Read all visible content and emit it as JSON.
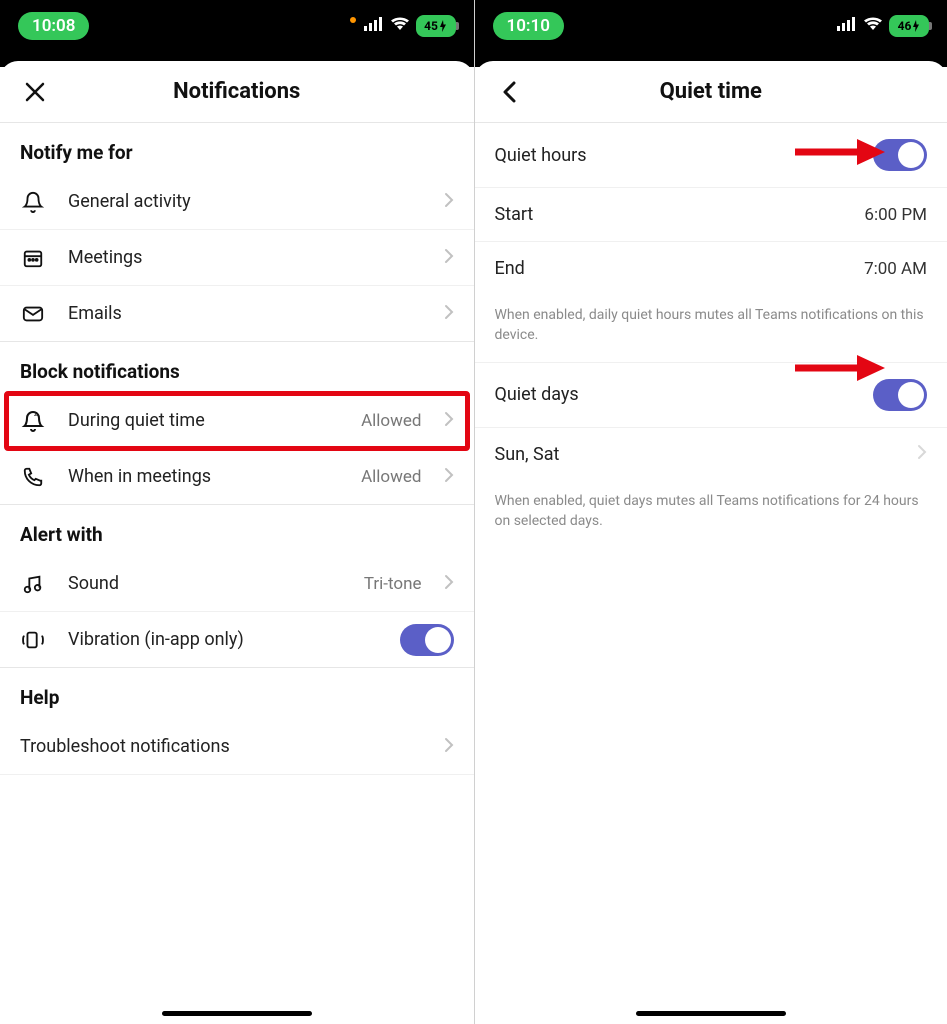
{
  "left": {
    "status": {
      "time": "10:08",
      "battery": "45"
    },
    "header": {
      "title": "Notifications"
    },
    "sections": {
      "notify_me_for": {
        "title": "Notify me for",
        "items": [
          {
            "label": "General activity",
            "icon": "bell-icon"
          },
          {
            "label": "Meetings",
            "icon": "calendar-icon"
          },
          {
            "label": "Emails",
            "icon": "mail-icon"
          }
        ]
      },
      "block_notifications": {
        "title": "Block notifications",
        "items": [
          {
            "label": "During quiet time",
            "value": "Allowed",
            "icon": "quiet-icon",
            "highlight": true
          },
          {
            "label": "When in meetings",
            "value": "Allowed",
            "icon": "phone-icon"
          }
        ]
      },
      "alert_with": {
        "title": "Alert with",
        "items": [
          {
            "label": "Sound",
            "value": "Tri-tone",
            "icon": "sound-icon"
          },
          {
            "label": "Vibration (in-app only)",
            "toggle": true,
            "icon": "vibrate-icon"
          }
        ]
      },
      "help": {
        "title": "Help",
        "items": [
          {
            "label": "Troubleshoot notifications"
          }
        ]
      }
    }
  },
  "right": {
    "status": {
      "time": "10:10",
      "battery": "46"
    },
    "header": {
      "title": "Quiet time"
    },
    "quiet_hours": {
      "label": "Quiet hours",
      "start_label": "Start",
      "start_value": "6:00 PM",
      "end_label": "End",
      "end_value": "7:00 AM",
      "footer": "When enabled, daily quiet hours mutes all Teams notifications on this device."
    },
    "quiet_days": {
      "label": "Quiet days",
      "value": "Sun, Sat",
      "footer": "When enabled, quiet days mutes all Teams notifications for 24 hours on selected days."
    }
  }
}
